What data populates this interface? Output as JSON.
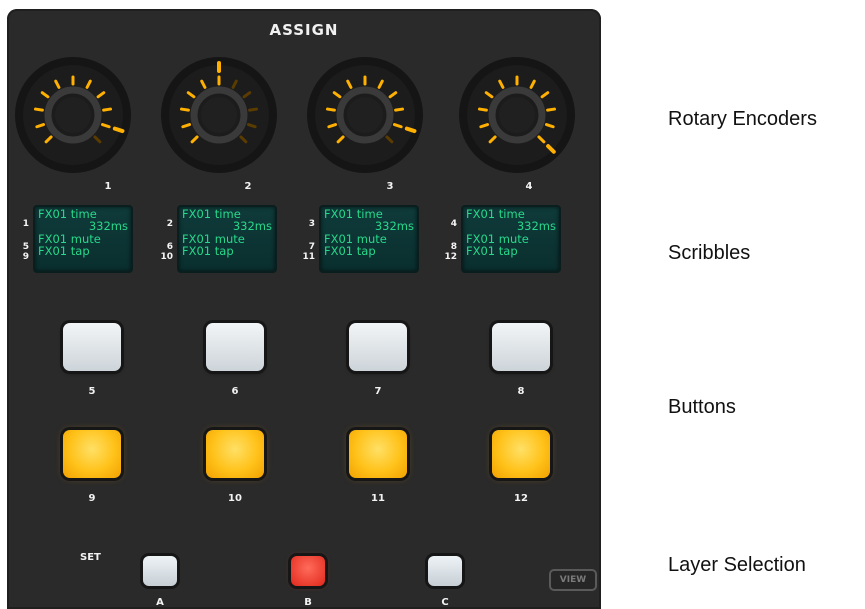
{
  "panel": {
    "title": "ASSIGN",
    "encoders": [
      {
        "number": "1",
        "level": 0.92
      },
      {
        "number": "2",
        "level": 0.55
      },
      {
        "number": "3",
        "level": 0.92
      },
      {
        "number": "4",
        "level": 1.0
      }
    ],
    "scribbles": [
      {
        "index_top": "1",
        "index_mid": "5",
        "index_bot": "9",
        "line1": "FX01 time",
        "line2": "332ms",
        "line3": "FX01 mute",
        "line4": "FX01 tap"
      },
      {
        "index_top": "2",
        "index_mid": "6",
        "index_bot": "10",
        "line1": "FX01 time",
        "line2": "332ms",
        "line3": "FX01 mute",
        "line4": "FX01 tap"
      },
      {
        "index_top": "3",
        "index_mid": "7",
        "index_bot": "11",
        "line1": "FX01 time",
        "line2": "332ms",
        "line3": "FX01 mute",
        "line4": "FX01 tap"
      },
      {
        "index_top": "4",
        "index_mid": "8",
        "index_bot": "12",
        "line1": "FX01 time",
        "line2": "332ms",
        "line3": "FX01 mute",
        "line4": "FX01 tap"
      }
    ],
    "buttons_row1": [
      "5",
      "6",
      "7",
      "8"
    ],
    "buttons_row2": [
      "9",
      "10",
      "11",
      "12"
    ],
    "set_label": "SET",
    "layers": [
      {
        "letter": "A",
        "active": false
      },
      {
        "letter": "B",
        "active": true
      },
      {
        "letter": "C",
        "active": false
      }
    ],
    "view_label": "VIEW"
  },
  "labels": {
    "rotary": "Rotary Encoders",
    "scribbles": "Scribbles",
    "buttons": "Buttons",
    "layer": "Layer Selection"
  },
  "colors": {
    "led": "#ffb000",
    "scribble_text": "#27d98a",
    "layer_active": "#e0281c"
  }
}
